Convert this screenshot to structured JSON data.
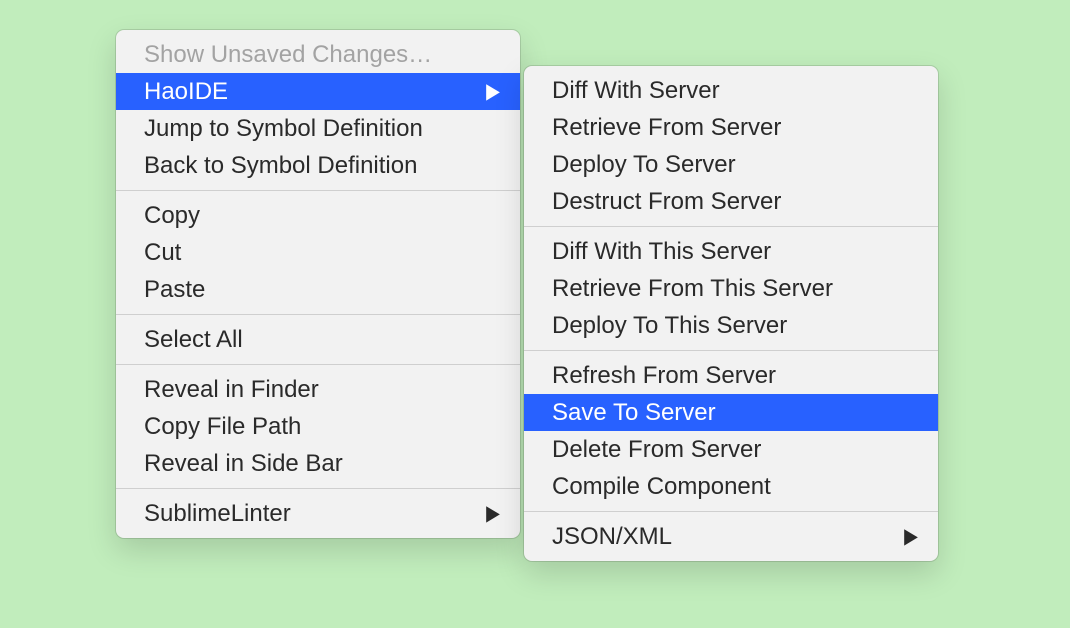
{
  "main_menu": {
    "items": [
      {
        "label": "Show Unsaved Changes…"
      },
      {
        "label": "HaoIDE"
      },
      {
        "label": "Jump to Symbol Definition"
      },
      {
        "label": "Back to Symbol Definition"
      },
      {
        "label": "Copy"
      },
      {
        "label": "Cut"
      },
      {
        "label": "Paste"
      },
      {
        "label": "Select All"
      },
      {
        "label": "Reveal in Finder"
      },
      {
        "label": "Copy File Path"
      },
      {
        "label": "Reveal in Side Bar"
      },
      {
        "label": "SublimeLinter"
      }
    ]
  },
  "sub_menu": {
    "items": [
      {
        "label": "Diff With Server"
      },
      {
        "label": "Retrieve From Server"
      },
      {
        "label": "Deploy To Server"
      },
      {
        "label": "Destruct From Server"
      },
      {
        "label": "Diff With This Server"
      },
      {
        "label": "Retrieve From This Server"
      },
      {
        "label": "Deploy To This Server"
      },
      {
        "label": "Refresh From Server"
      },
      {
        "label": "Save To Server"
      },
      {
        "label": "Delete From Server"
      },
      {
        "label": "Compile Component"
      },
      {
        "label": "JSON/XML"
      }
    ]
  }
}
